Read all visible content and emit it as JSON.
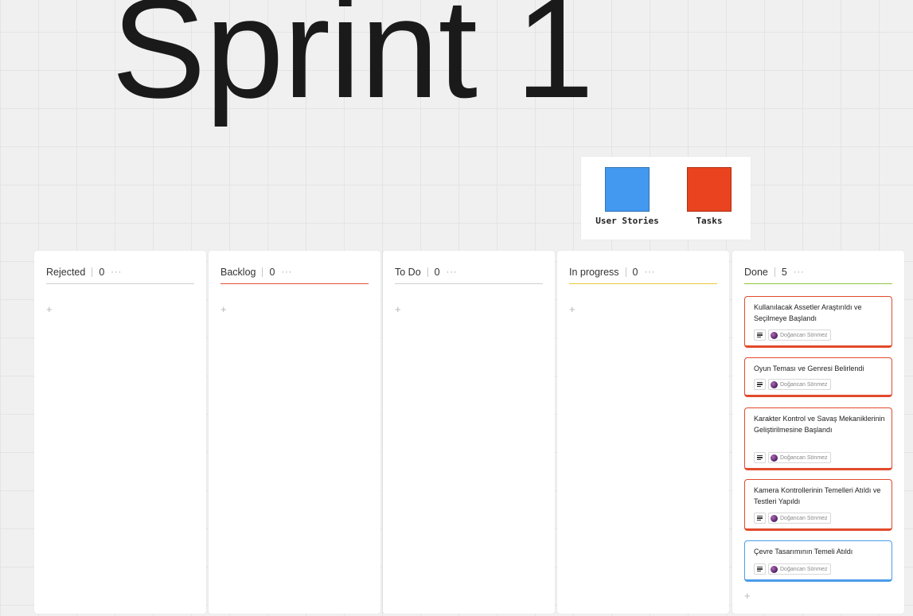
{
  "title": "Sprint 1",
  "legend": {
    "items": [
      {
        "label": "User Stories",
        "color": "#4299ef"
      },
      {
        "label": "Tasks",
        "color": "#e9431f"
      }
    ]
  },
  "colors": {
    "task_card_border": "#e24a2c",
    "story_card_border": "#4a9ce8"
  },
  "columns": [
    {
      "name": "Rejected",
      "count": "0",
      "menu": "···",
      "add": "+",
      "underline_color": "#cfcfcf"
    },
    {
      "name": "Backlog",
      "count": "0",
      "menu": "···",
      "add": "+",
      "underline_color": "#e2533a"
    },
    {
      "name": "To Do",
      "count": "0",
      "menu": "···",
      "add": "+",
      "underline_color": "#cfcfcf"
    },
    {
      "name": "In progress",
      "count": "0",
      "menu": "···",
      "add": "+",
      "underline_color": "#e8c93a"
    },
    {
      "name": "Done",
      "count": "5",
      "menu": "···",
      "add": "+",
      "underline_color": "#8cc63f",
      "cards": [
        {
          "title": "Kullanılacak Assetler Araştırıldı ve Seçilmeye Başlandı",
          "assignee": "Doğancan Sönmez",
          "kind": "task"
        },
        {
          "title": "Oyun Teması ve Genresi Belirlendi",
          "assignee": "Doğancan Sönmez",
          "kind": "task"
        },
        {
          "title": "Karakter Kontrol ve Savaş Mekaniklerinin Geliştirilmesine Başlandı",
          "assignee": "Doğancan Sönmez",
          "kind": "task"
        },
        {
          "title": "Kamera Kontrollerinin Temelleri Atıldı ve Testleri Yapıldı",
          "assignee": "Doğancan Sönmez",
          "kind": "task"
        },
        {
          "title": "Çevre Tasarımının Temeli Atıldı",
          "assignee": "Doğancan Sönmez",
          "kind": "story"
        }
      ]
    }
  ]
}
